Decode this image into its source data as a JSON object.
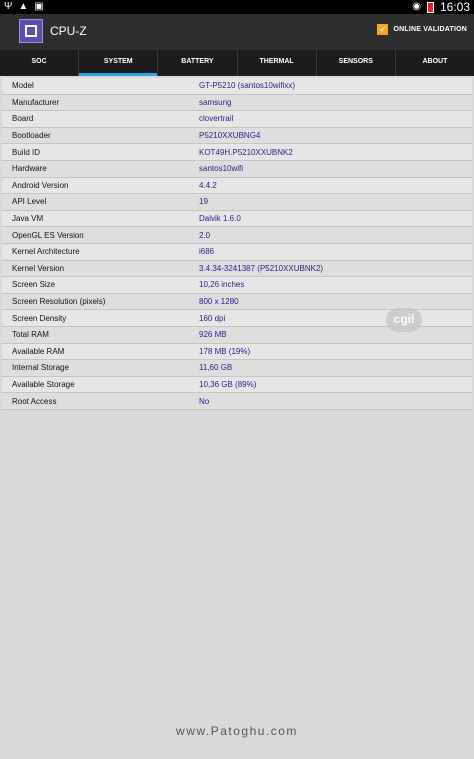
{
  "statusbar": {
    "left_icons": [
      "usb-icon",
      "warning-icon",
      "image-icon"
    ],
    "time": "16:03",
    "battery_color": "#e22222"
  },
  "app": {
    "title": "CPU-Z",
    "validation_label": "ONLINE VALIDATION",
    "accent": "#2ea4e8"
  },
  "tabs": [
    {
      "label": "SOC",
      "active": false
    },
    {
      "label": "SYSTEM",
      "active": true
    },
    {
      "label": "BATTERY",
      "active": false
    },
    {
      "label": "THERMAL",
      "active": false
    },
    {
      "label": "SENSORS",
      "active": false
    },
    {
      "label": "ABOUT",
      "active": false
    }
  ],
  "rows": [
    {
      "label": "Model",
      "value": "GT-P5210 (santos10wifixx)"
    },
    {
      "label": "Manufacturer",
      "value": "samsung"
    },
    {
      "label": "Board",
      "value": "clovertrail"
    },
    {
      "label": "Bootloader",
      "value": "P5210XXUBNG4"
    },
    {
      "label": "Build ID",
      "value": "KOT49H.P5210XXUBNK2"
    },
    {
      "label": "Hardware",
      "value": "santos10wifi"
    },
    {
      "label": "Android Version",
      "value": "4.4.2"
    },
    {
      "label": "API Level",
      "value": "19"
    },
    {
      "label": "Java VM",
      "value": "Dalvik 1.6.0"
    },
    {
      "label": "OpenGL ES Version",
      "value": "2.0"
    },
    {
      "label": "Kernel Architecture",
      "value": "i686"
    },
    {
      "label": "Kernel Version",
      "value": "3.4.34-3241387 (P5210XXUBNK2)"
    },
    {
      "label": "Screen Size",
      "value": "10,26 inches"
    },
    {
      "label": "Screen Resolution (pixels)",
      "value": "800 x 1280"
    },
    {
      "label": "Screen Density",
      "value": "160 dpi"
    },
    {
      "label": "Total RAM",
      "value": "926 MB"
    },
    {
      "label": "Available RAM",
      "value": "178 MB  (19%)"
    },
    {
      "label": "Internal Storage",
      "value": "11,60 GB"
    },
    {
      "label": "Available Storage",
      "value": "10,36 GB (89%)"
    },
    {
      "label": "Root Access",
      "value": "No"
    }
  ],
  "watermark": {
    "badge": "cgil",
    "footer": "www.Patoghu.com"
  }
}
